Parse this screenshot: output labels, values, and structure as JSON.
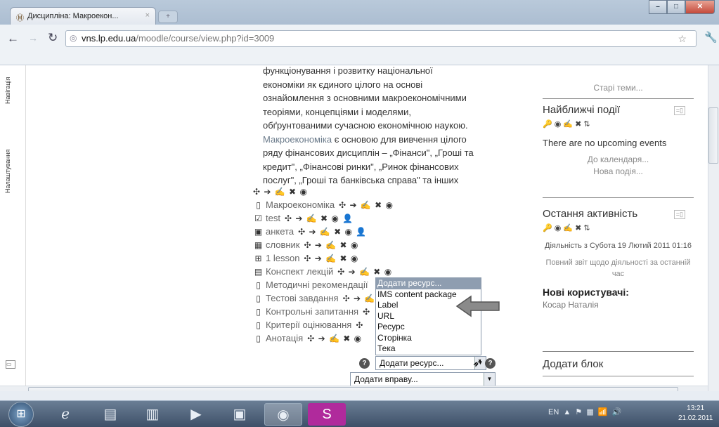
{
  "browser": {
    "tab_title": "Дисципліна: Макроекон...",
    "url_domain": "vns.lp.edu.ua",
    "url_path": "/moodle/course/view.php?id=3009"
  },
  "sidebar": {
    "tabs": [
      "Навігація",
      "Налаштування"
    ]
  },
  "content": {
    "paragraph_lines": [
      "функціонування і розвитку національної",
      "економіки як єдиного цілого на основі",
      "ознайомлення з основними макроекономічними",
      "теоріями, концепціями і моделями,",
      "обґрунтованими сучасною економічною наукою."
    ],
    "paragraph2_link": "Макроекономіка",
    "paragraph2_rest": " є основою для вивчення цілого",
    "paragraph3_lines": [
      "ряду фінансових дисциплін – „Фінанси\", „Гроші та",
      "кредит\", „Фінансові ринки\", „Ринок фінансових",
      "послуг\", „Гроші та банківська справа\" та інших"
    ],
    "edit_icons": "+ → ✎ ✕ 👁",
    "activities": [
      {
        "icon": "page-icon",
        "label": "Макроекономіка",
        "edit": "✣ ➔ ✍ ✖ ◉"
      },
      {
        "icon": "quiz-icon",
        "label": "test",
        "edit": "✣ ➔ ✍ ✖ ◉ 👤"
      },
      {
        "icon": "feedback-icon",
        "label": "анкета",
        "edit": "✣ ➔ ✍ ✖ ◉ 👤"
      },
      {
        "icon": "glossary-icon",
        "label": "словник",
        "edit": "✣ ➔ ✍ ✖ ◉"
      },
      {
        "icon": "lesson-icon",
        "label": "1 lesson",
        "edit": "✣ ➔ ✍ ✖ ◉"
      },
      {
        "icon": "file-icon",
        "label": "Конспект лекцій",
        "edit": "✣ ➔ ✍ ✖ ◉"
      },
      {
        "icon": "page-icon",
        "label": "Методичні рекомендації",
        "edit": ""
      },
      {
        "icon": "page-icon",
        "label": "Тестові завдання",
        "edit": "✣ ➔ ✍"
      },
      {
        "icon": "page-icon",
        "label": "Контрольні запитання",
        "edit": "✣"
      },
      {
        "icon": "page-icon",
        "label": "Критерії оцінювання",
        "edit": "✣"
      },
      {
        "icon": "page-icon",
        "label": "Анотація",
        "edit": "✣ ➔ ✍ ✖ ◉"
      }
    ],
    "resource_dropdown": {
      "options": [
        "Додати ресурс...",
        "IMS content package",
        "Label",
        "URL",
        "Ресурс",
        "Сторінка",
        "Тека"
      ],
      "selected_index": 0
    },
    "add_resource_value": "Додати ресурс...",
    "add_activity_value": "Додати вправу...",
    "help_glyph": "?"
  },
  "right": {
    "old_topics": "Старі теми...",
    "upcoming": {
      "title": "Найближчі події",
      "tools": "🔑 ◉ ✍ ✖ ⇅",
      "text": "There are no upcoming events",
      "link1": "До календаря...",
      "link2": "Нова подія..."
    },
    "recent": {
      "title": "Остання активність",
      "tools": "🔑 ◉ ✍ ✖ ⇅",
      "since": "Діяльність з Субота 19 Лютий 2011 01:16",
      "report": "Повний звіт щодо діяльності за останній час",
      "new_users_title": "Нові користувачі:",
      "new_user": "Косар Наталія"
    },
    "add_block": "Додати блок"
  },
  "taskbar": {
    "lang": "EN",
    "time": "13:21",
    "date": "21.02.2011"
  }
}
